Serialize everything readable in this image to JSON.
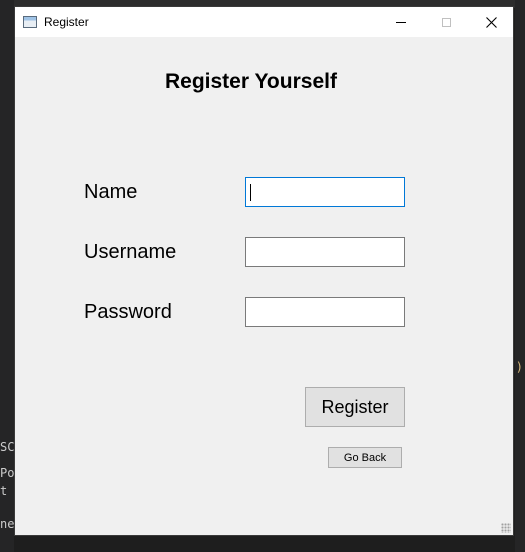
{
  "window": {
    "title": "Register",
    "controls": {
      "minimize": "–",
      "maximize": "□",
      "close": "✕"
    }
  },
  "form": {
    "heading": "Register Yourself",
    "fields": [
      {
        "label": "Name",
        "value": "",
        "placeholder": ""
      },
      {
        "label": "Username",
        "value": "",
        "placeholder": ""
      },
      {
        "label": "Password",
        "value": "",
        "placeholder": ""
      }
    ],
    "register_label": "Register",
    "goback_label": "Go Back"
  },
  "background": {
    "left_fragments": [
      "SC",
      "Po",
      "t",
      "ne"
    ],
    "right_fragment": ")"
  },
  "colors": {
    "focus_border": "#0078d7",
    "window_bg": "#f0f0f0"
  },
  "icons": [
    "app-icon",
    "minimize-icon",
    "maximize-icon",
    "close-icon"
  ]
}
